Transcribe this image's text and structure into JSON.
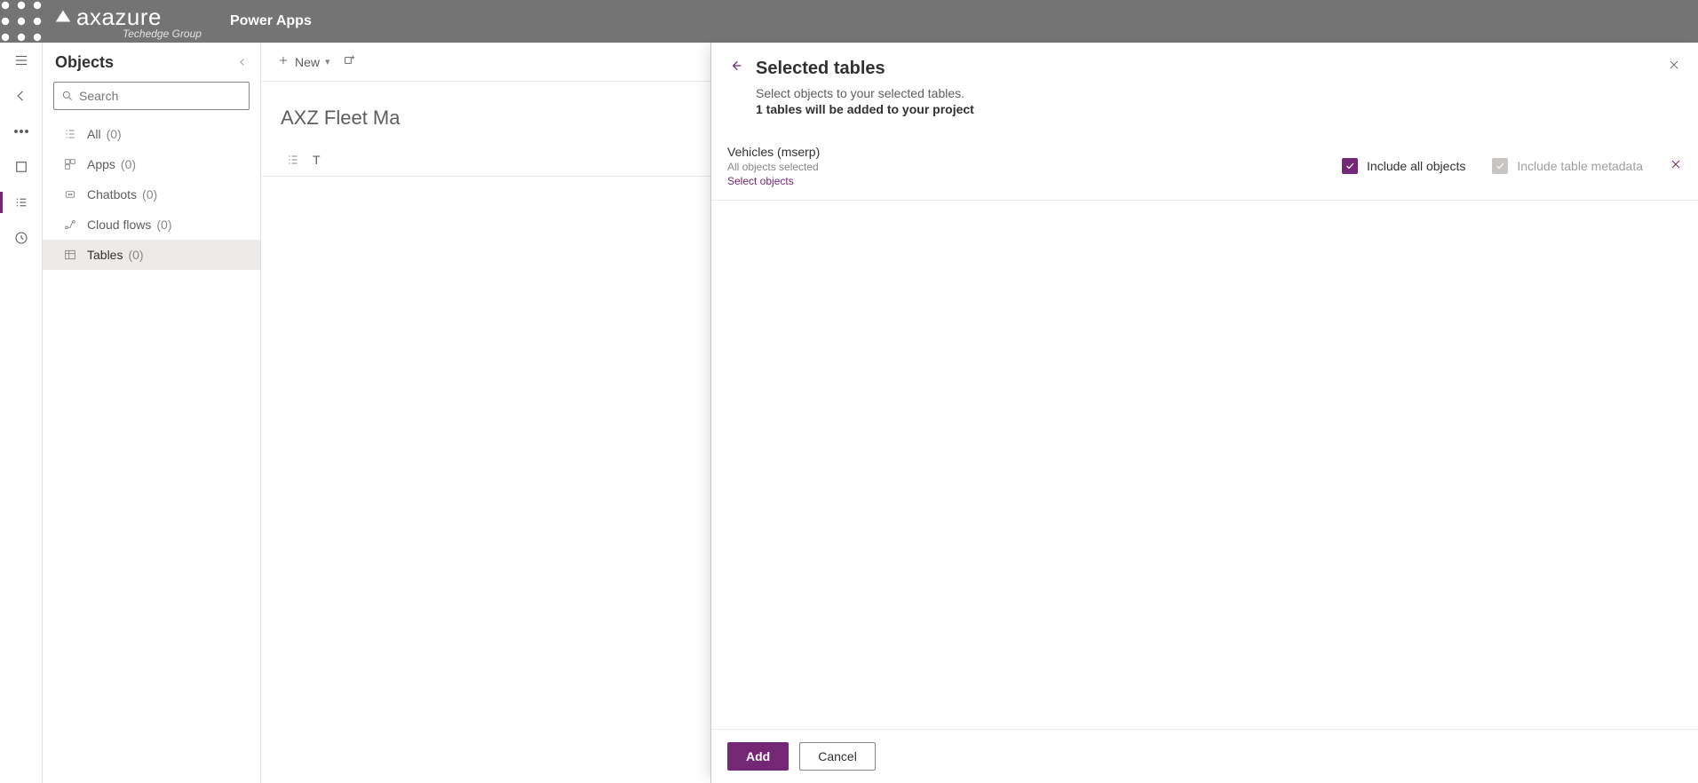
{
  "header": {
    "brand": "axazure",
    "brand_sub": "Techedge Group",
    "app": "Power Apps"
  },
  "sidebar": {
    "title": "Objects",
    "search_placeholder": "Search",
    "items": [
      {
        "label": "All",
        "count": "(0)"
      },
      {
        "label": "Apps",
        "count": "(0)"
      },
      {
        "label": "Chatbots",
        "count": "(0)"
      },
      {
        "label": "Cloud flows",
        "count": "(0)"
      },
      {
        "label": "Tables",
        "count": "(0)"
      }
    ]
  },
  "cmdbar": {
    "new_label": "New"
  },
  "main": {
    "page_title": "AXZ Fleet Ma",
    "tables_header": "T"
  },
  "panel": {
    "title": "Selected tables",
    "subtitle": "Select objects to your selected tables.",
    "summary": "1 tables will be added to your project",
    "table": {
      "name": "Vehicles (mserp)",
      "hint": "All objects selected",
      "link": "Select objects"
    },
    "include_all": "Include all objects",
    "include_meta": "Include table metadata",
    "add": "Add",
    "cancel": "Cancel"
  }
}
